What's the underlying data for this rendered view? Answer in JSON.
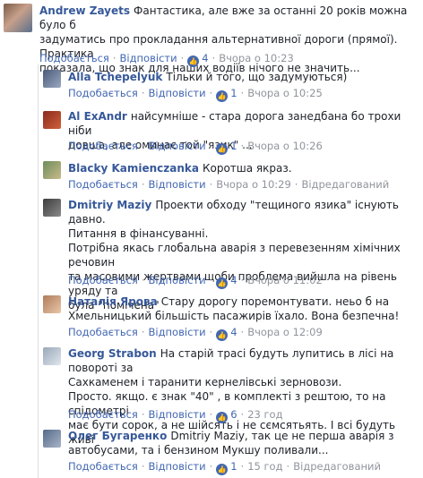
{
  "comments": [
    {
      "author": "Andrew Zayets",
      "lines": [
        "Фантастика, але вже за останні 20 років можна було б",
        "задуматись про прокладання альтернативної дороги (прямої). Практика",
        "показала, що знак для наших водіїв нічого не значить..."
      ],
      "like": "Подобається",
      "reply": "Відповісти",
      "likes": "4",
      "time": "Вчора о 10:23"
    },
    {
      "author": "Alla Tchepelyuk",
      "lines": [
        "Тільки й того, що задумуються)"
      ],
      "like": "Подобається",
      "reply": "Відповісти",
      "likes": "1",
      "time": "Вчора о 10:25"
    },
    {
      "author": "Al ExAndr",
      "lines": [
        "найсумніше - стара дорога занедбана бо трохи ніби",
        "довша, але оминає той \"язик\" ..."
      ],
      "like": "Подобається",
      "reply": "Відповісти",
      "likes": "1",
      "time": "Вчора о 10:26"
    },
    {
      "author": "Blacky Kamienczanka",
      "lines": [
        "Коротша якраз."
      ],
      "like": "Подобається",
      "reply": "Відповісти",
      "time": "Вчора о 10:29",
      "edited": "Відредагований"
    },
    {
      "author": "Dmitriy Maziy",
      "lines": [
        "Проекти обходу \"тещиного язика\" існують давно.",
        "Питання в фінансуванні.",
        "Потрібна якась глобальна аварія з перевезенням хімічних речовин",
        "та масовими жертвами щоби проблема вийшла на рівень уряду та",
        "була \"помічена\""
      ],
      "like": "Подобається",
      "reply": "Відповісти",
      "likes": "4",
      "time": "Вчора о 11:02"
    },
    {
      "author": "Наталія Ярова",
      "lines": [
        "Стару дорогу поремонтувати. неьо б на",
        "Хмельницький більшість пасажирів їхало. Вона безпечна!"
      ],
      "like": "Подобається",
      "reply": "Відповісти",
      "likes": "4",
      "time": "Вчора о 12:09"
    },
    {
      "author": "Georg Strabon",
      "lines": [
        "На старій трасі будуть лупитись в лісі на повороті за",
        "Сахкаменем і таранити кернелівські зерновози.",
        "Просто. якщо. є знак \"40\" , в комплекті з рештою, то на спідометрі",
        "має бути сорок, а не шійсять і не сємсятьять. І всі будуть живі"
      ],
      "like": "Подобається",
      "reply": "Відповісти",
      "likes": "6",
      "time": "23 год"
    },
    {
      "author": "Олег Бугаренко",
      "lines": [
        "Dmitriy Maziy, так це не перша аварія з",
        "автобусами, та і бензином Мукшу поливали..."
      ],
      "like": "Подобається",
      "reply": "Відповісти",
      "likes": "1",
      "time": "15 год",
      "edited": "Відредагований"
    }
  ],
  "colors": {
    "link": "#365899",
    "action": "#4267b2",
    "meta": "#90949c"
  }
}
